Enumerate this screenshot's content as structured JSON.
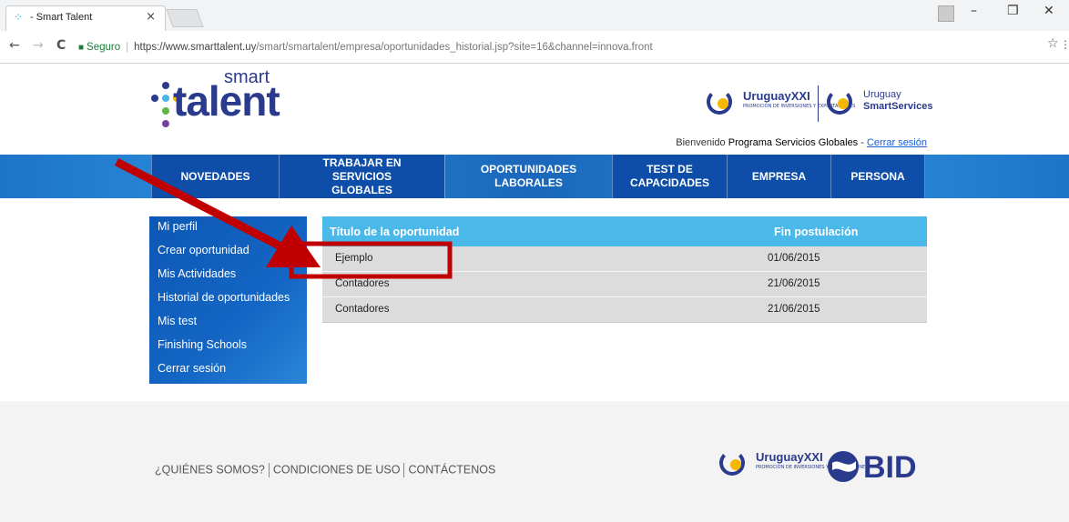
{
  "browser": {
    "tab_title": "- Smart Talent",
    "tab_close": "×",
    "window_controls": {
      "minimize": "–",
      "restore": "❐",
      "close": "✕"
    },
    "nav": {
      "back": "←",
      "forward": "→",
      "reload": "C"
    },
    "secure_label": "Seguro",
    "url_host": "https://www.smarttalent.uy",
    "url_path": "/smart/smartalent/empresa/oportunidades_historial.jsp?site=16&channel=innova.front"
  },
  "header": {
    "logo_top": "smart",
    "logo_main": "talent",
    "partner1_name": "UruguayXXI",
    "partner1_sub": "PROMOCIÓN DE INVERSIONES Y EXPORTACIONES",
    "partner2_line1": "Uruguay",
    "partner2_line2": "SmartServices",
    "welcome_prefix": "Bienvenido",
    "welcome_name": "Programa Servicios Globales",
    "welcome_sep": " - ",
    "logout_link": "Cerrar sesión"
  },
  "nav": {
    "items": [
      {
        "label": "NOVEDADES"
      },
      {
        "label": "TRABAJAR EN SERVICIOS GLOBALES"
      },
      {
        "label": "OPORTUNIDADES LABORALES"
      },
      {
        "label": "TEST DE CAPACIDADES"
      },
      {
        "label": "EMPRESA"
      },
      {
        "label": "PERSONA"
      }
    ]
  },
  "sidebar": {
    "items": [
      {
        "label": "Mi perfil"
      },
      {
        "label": "Crear oportunidad"
      },
      {
        "label": "Mis Actividades"
      },
      {
        "label": "Historial de oportunidades"
      },
      {
        "label": "Mis test"
      },
      {
        "label": "Finishing Schools"
      },
      {
        "label": "Cerrar sesión"
      }
    ]
  },
  "table": {
    "headers": {
      "title": "Título de la oportunidad",
      "end_date": "Fin postulación"
    },
    "rows": [
      {
        "title": "Ejemplo",
        "end_date": "01/06/2015"
      },
      {
        "title": "Contadores",
        "end_date": "21/06/2015"
      },
      {
        "title": "Contadores",
        "end_date": "21/06/2015"
      }
    ]
  },
  "footer": {
    "links": [
      "¿QUIÉNES SOMOS?",
      "CONDICIONES DE USO",
      "CONTÁCTENOS"
    ],
    "partner_name": "UruguayXXI",
    "partner_sub": "PROMOCIÓN DE INVERSIONES Y EXPORTACIONES",
    "bid_label": "BID"
  },
  "colors": {
    "brand": "#2a3a8c",
    "nav_blue": "#1d74c9",
    "table_header": "#4ab8e8",
    "annotation": "#c00000"
  }
}
